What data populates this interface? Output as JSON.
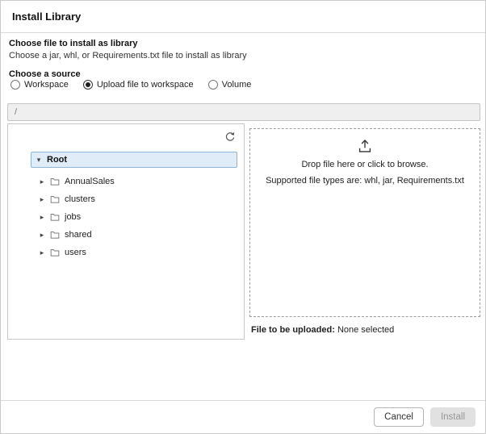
{
  "dialog": {
    "title": "Install Library"
  },
  "file_section": {
    "heading": "Choose file to install as library",
    "subheading": "Choose a jar, whl, or Requirements.txt file to install as library"
  },
  "source_section": {
    "heading": "Choose a source",
    "options": [
      {
        "label": "Workspace",
        "selected": false
      },
      {
        "label": "Upload file to workspace",
        "selected": true
      },
      {
        "label": "Volume",
        "selected": false
      }
    ]
  },
  "path_input": {
    "value": "/"
  },
  "tree": {
    "root": {
      "label": "Root",
      "expanded": true,
      "selected": true
    },
    "items": [
      {
        "label": "AnnualSales"
      },
      {
        "label": "clusters"
      },
      {
        "label": "jobs"
      },
      {
        "label": "shared"
      },
      {
        "label": "users"
      }
    ]
  },
  "dropzone": {
    "line1": "Drop file here or click to browse.",
    "line2": "Supported file types are: whl, jar, Requirements.txt",
    "file_label": "File to be uploaded:",
    "file_value": "None selected"
  },
  "footer": {
    "cancel_label": "Cancel",
    "install_label": "Install"
  },
  "icons": {
    "refresh": "refresh-icon",
    "upload": "upload-icon",
    "folder": "folder-icon",
    "caret_down": "caret-down-icon",
    "caret_right": "caret-right-icon",
    "colors": {
      "selected_row_bg": "#e0ecf7",
      "selected_row_border": "#8fb4d6"
    }
  }
}
